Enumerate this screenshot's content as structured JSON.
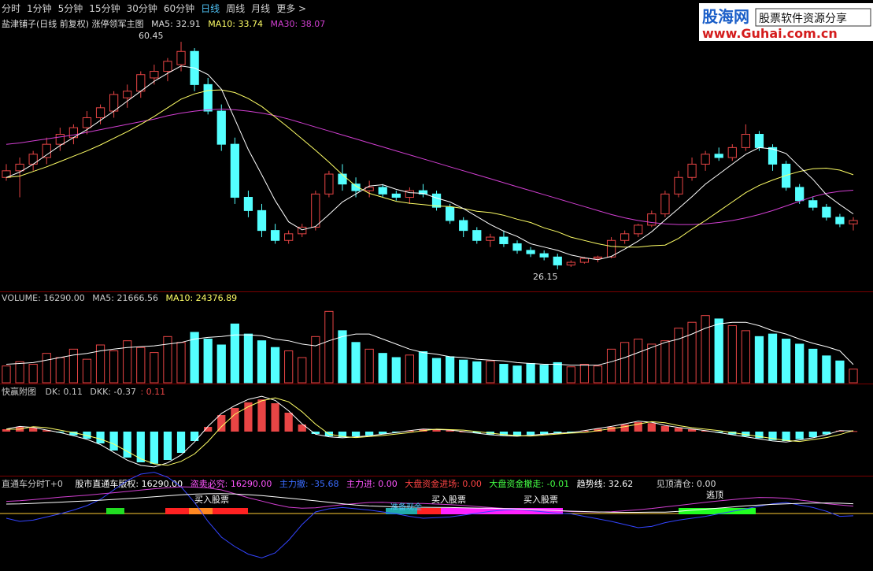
{
  "tabs": [
    {
      "label": "分时",
      "active": false
    },
    {
      "label": "1分钟",
      "active": false
    },
    {
      "label": "5分钟",
      "active": false
    },
    {
      "label": "15分钟",
      "active": false
    },
    {
      "label": "30分钟",
      "active": false
    },
    {
      "label": "60分钟",
      "active": false
    },
    {
      "label": "日线",
      "active": true
    },
    {
      "label": "周线",
      "active": false
    },
    {
      "label": "月线",
      "active": false
    },
    {
      "label": "更多 >",
      "active": false
    }
  ],
  "logo": {
    "brand": "股海网",
    "tagline": "股票软件资源分享",
    "url": "www.Guhai.com.cn"
  },
  "main_header": {
    "title": "盐津铺子(日线 前复权) 涨停领军主图",
    "ma5": "MA5: 32.91",
    "ma10": "MA10: 33.74",
    "ma30": "MA30: 38.07"
  },
  "volume_header": {
    "title": "VOLUME: 16290.00",
    "ma5": "MA5: 21666.56",
    "ma10": "MA10: 24376.89"
  },
  "osc_header": {
    "title": "快赢附图",
    "dk": "DK: 0.11",
    "dkk": "DKK: -0.37",
    "diff": ": 0.11"
  },
  "bottom_header": {
    "title": "直通车分时T+0",
    "label1": "股市直通车版权: 16290.00",
    "label2": "盗卖必究: 16290.00",
    "label3": "主力撤: -35.68",
    "label4": "主力进: 0.00",
    "label5": "大盘资金进场: 0.00",
    "label6": "大盘资金撤走: -0.01",
    "label7": "趋势线: 32.62",
    "label8": "见顶清仓: 0.00"
  },
  "annotations": {
    "high": "60.45",
    "low": "26.15",
    "buy1": "买入股票",
    "buy2": "买入股票",
    "buy3": "买入股票",
    "top": "逃顶",
    "prep": "准备现金"
  },
  "colors": {
    "up": "#e84545",
    "down": "#54ffff",
    "ma5": "#ffffff",
    "ma10": "#ffff66",
    "ma30": "#d23fd2",
    "bg": "#000000",
    "divider": "#7a0000"
  },
  "chart_data": {
    "type": "candlestick",
    "ylim": [
      24,
      62
    ],
    "candles": [
      [
        40,
        42,
        39.5,
        41
      ],
      [
        41,
        43,
        37,
        42
      ],
      [
        42,
        44,
        41,
        43.5
      ],
      [
        43,
        46,
        42,
        45
      ],
      [
        45,
        47.5,
        44,
        46.5
      ],
      [
        46,
        48,
        45,
        47.5
      ],
      [
        47.5,
        50,
        46.5,
        49
      ],
      [
        49,
        51,
        48,
        50.5
      ],
      [
        50,
        53,
        49,
        52.5
      ],
      [
        52,
        54,
        50.5,
        53
      ],
      [
        53,
        56,
        52,
        55.5
      ],
      [
        55,
        57,
        54,
        56
      ],
      [
        56,
        58,
        54.5,
        57.5
      ],
      [
        57,
        60.45,
        56,
        59
      ],
      [
        59,
        59.5,
        53,
        54
      ],
      [
        54,
        55,
        49.5,
        50
      ],
      [
        50,
        51,
        44,
        45
      ],
      [
        45,
        46,
        36,
        37
      ],
      [
        37,
        38,
        34,
        35
      ],
      [
        35,
        36,
        31,
        32
      ],
      [
        32,
        33,
        30,
        30.5
      ],
      [
        30.5,
        32,
        30,
        31.5
      ],
      [
        31.5,
        33,
        31,
        32.5
      ],
      [
        32.5,
        38,
        32,
        37.5
      ],
      [
        37.5,
        41,
        37,
        40.5
      ],
      [
        40.5,
        42,
        38,
        39
      ],
      [
        39,
        40,
        37,
        38
      ],
      [
        38,
        39.5,
        37,
        38.5
      ],
      [
        38.5,
        39,
        37,
        37.5
      ],
      [
        37.5,
        38,
        36.5,
        37
      ],
      [
        37,
        38.5,
        36,
        38
      ],
      [
        38,
        39,
        37,
        37.5
      ],
      [
        37.5,
        38,
        35,
        35.5
      ],
      [
        35.5,
        36,
        33,
        33.5
      ],
      [
        33.5,
        34,
        31,
        32
      ],
      [
        32,
        32.5,
        30,
        30.5
      ],
      [
        30.5,
        31.5,
        29.5,
        31
      ],
      [
        31,
        32,
        29.5,
        30
      ],
      [
        30,
        30.5,
        28.5,
        29
      ],
      [
        29,
        29.5,
        28,
        28.5
      ],
      [
        28.5,
        29,
        27.5,
        28
      ],
      [
        28,
        28.5,
        26.15,
        26.8
      ],
      [
        26.8,
        27.5,
        26.5,
        27.2
      ],
      [
        27.2,
        28,
        27,
        27.8
      ],
      [
        27.8,
        28.2,
        27.2,
        28
      ],
      [
        28,
        31,
        27.8,
        30.5
      ],
      [
        30.5,
        32,
        30,
        31.5
      ],
      [
        31.5,
        33,
        31,
        32.8
      ],
      [
        32.8,
        35,
        32.5,
        34.5
      ],
      [
        34.5,
        38,
        34,
        37.5
      ],
      [
        37.5,
        41,
        37,
        40
      ],
      [
        40,
        43,
        39.5,
        42
      ],
      [
        42,
        44,
        41,
        43.5
      ],
      [
        43.5,
        44.5,
        42.5,
        43
      ],
      [
        43,
        45,
        42.5,
        44.5
      ],
      [
        44.5,
        48,
        44,
        46.5
      ],
      [
        46.5,
        47,
        44,
        44.5
      ],
      [
        44.5,
        45,
        41,
        42
      ],
      [
        42,
        42.5,
        38,
        38.5
      ],
      [
        38.5,
        39,
        36,
        36.5
      ],
      [
        36.5,
        37,
        35,
        35.5
      ],
      [
        35.5,
        36,
        33.5,
        34
      ],
      [
        34,
        34.5,
        32.5,
        33
      ],
      [
        33,
        34,
        32,
        33.5
      ]
    ],
    "ma5": [
      40,
      40.8,
      42,
      43.4,
      44.8,
      46,
      47.2,
      48.6,
      50,
      51.5,
      53,
      54.5,
      55.7,
      56.8,
      56.5,
      55.5,
      53.3,
      48.8,
      44.2,
      40.4,
      36.5,
      33.3,
      32.1,
      32.6,
      34.4,
      36.3,
      37.5,
      38.7,
      38.9,
      38.2,
      37.7,
      37.6,
      36.9,
      36.3,
      35.3,
      34.1,
      32.9,
      31.9,
      31.1,
      30,
      29.5,
      29,
      28.3,
      27.9,
      27.6,
      28.1,
      29.2,
      30.4,
      31.8,
      33.6,
      35.3,
      37.1,
      39,
      40.5,
      42,
      43.5,
      44.5,
      44.3,
      43.6,
      41.6,
      39.7,
      37.4,
      35.9,
      34.5
    ],
    "ma10": [
      40,
      40.2,
      40.9,
      41.6,
      42.4,
      43.2,
      44,
      44.9,
      45.9,
      46.9,
      48,
      49.2,
      50.5,
      51.8,
      52.6,
      53.1,
      53.2,
      52.8,
      51.9,
      50.7,
      49.1,
      47.5,
      45.8,
      44.1,
      42.3,
      40.4,
      38.7,
      37.6,
      37,
      36.4,
      36.1,
      35.9,
      35.7,
      35.6,
      35.3,
      34.9,
      34.7,
      34.3,
      33.7,
      33.2,
      32.4,
      31.8,
      31,
      30.5,
      30,
      29.6,
      29.5,
      29.5,
      29.7,
      29.8,
      30.8,
      32.2,
      33.5,
      34.9,
      36.3,
      37.7,
      38.8,
      39.6,
      40.3,
      40.9,
      41.3,
      41.4,
      41.1,
      40.4
    ],
    "ma30": [
      45,
      45.2,
      45.5,
      45.8,
      46.1,
      46.4,
      46.8,
      47.2,
      47.6,
      48,
      48.4,
      48.8,
      49.3,
      49.7,
      50,
      50.2,
      50.3,
      50.2,
      50,
      49.7,
      49.3,
      48.8,
      48.2,
      47.6,
      47,
      46.4,
      45.8,
      45.2,
      44.6,
      44,
      43.4,
      42.8,
      42.2,
      41.6,
      41,
      40.4,
      39.8,
      39.2,
      38.6,
      38,
      37.4,
      36.8,
      36.2,
      35.6,
      35,
      34.4,
      33.9,
      33.5,
      33.2,
      33,
      32.9,
      32.9,
      33,
      33.2,
      33.5,
      33.9,
      34.4,
      35,
      35.7,
      36.4,
      37.1,
      37.6,
      37.9,
      38.07
    ],
    "volume": [
      20,
      25,
      22,
      35,
      30,
      40,
      28,
      45,
      38,
      50,
      42,
      36,
      55,
      48,
      60,
      52,
      45,
      70,
      58,
      50,
      42,
      38,
      30,
      55,
      85,
      62,
      48,
      40,
      35,
      30,
      33,
      37,
      29,
      31,
      27,
      25,
      26,
      22,
      20,
      23,
      21,
      24,
      19,
      22,
      20,
      40,
      48,
      52,
      46,
      50,
      65,
      72,
      80,
      76,
      68,
      62,
      55,
      58,
      52,
      46,
      40,
      32,
      26,
      16.29
    ],
    "volume_vol_ma5": [
      22,
      23,
      24,
      27,
      30,
      33,
      35,
      38,
      40,
      42,
      43,
      44,
      46,
      48,
      52,
      54,
      55,
      57,
      57,
      56,
      52,
      50,
      46,
      44,
      50,
      55,
      58,
      58,
      52,
      46,
      40,
      36,
      34,
      31,
      30,
      28,
      27,
      26,
      24,
      23,
      22,
      22,
      21,
      21,
      21,
      25,
      30,
      36,
      42,
      48,
      52,
      58,
      65,
      70,
      72,
      72,
      68,
      62,
      58,
      52,
      47,
      43,
      38,
      21.67
    ],
    "osc": [
      0.5,
      1,
      0.8,
      0.3,
      -0.2,
      -0.8,
      -1.5,
      -2.5,
      -4,
      -5.5,
      -6.5,
      -6.8,
      -6,
      -4.5,
      -2,
      1,
      3.5,
      5,
      6.2,
      6.8,
      6,
      4,
      1.5,
      -0.5,
      -1,
      -1.2,
      -1,
      -0.8,
      -0.5,
      -0.2,
      0.2,
      0.5,
      0.4,
      0.3,
      0,
      -0.3,
      -0.6,
      -0.8,
      -0.9,
      -0.7,
      -0.5,
      -0.3,
      -0.2,
      0.2,
      0.6,
      1,
      1.5,
      2,
      1.8,
      1.2,
      0.8,
      0.5,
      0.2,
      -0.2,
      -0.6,
      -1,
      -1.4,
      -1.8,
      -2,
      -1.6,
      -1.2,
      -0.6,
      0.2,
      0.11
    ]
  }
}
